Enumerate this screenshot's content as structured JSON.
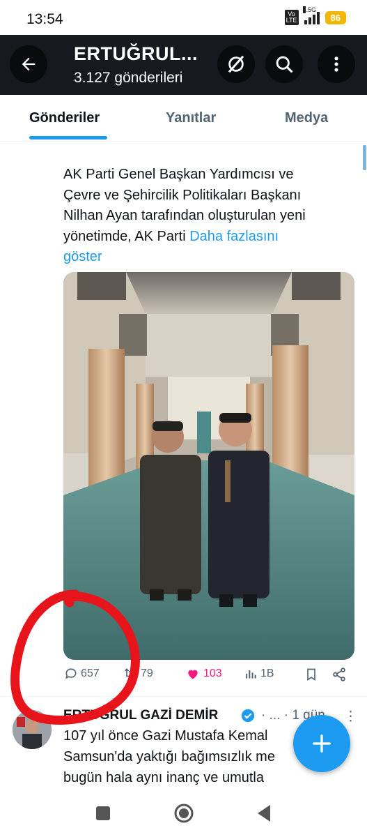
{
  "status_bar": {
    "time": "13:54",
    "volte_label": "Vo LTE",
    "network": "4.5G",
    "battery": "86"
  },
  "header": {
    "title": "ERTUĞRUL...",
    "subtitle": "3.127 gönderileri",
    "icons": [
      "back-arrow-icon",
      "grok-icon",
      "search-icon",
      "more-vertical-icon"
    ]
  },
  "tabs": [
    {
      "label": "Gönderiler",
      "active": true
    },
    {
      "label": "Yanıtlar",
      "active": false
    },
    {
      "label": "Medya",
      "active": false
    }
  ],
  "tweet": {
    "text_lines": [
      "AK Parti Genel Başkan Yardımcısı ve",
      "Çevre ve Şehircilik Politikaları Başkanı",
      "Nilhan Ayan tarafından oluşturulan yeni",
      "yönetimde,  AK Parti "
    ],
    "show_more": "Daha fazlasını",
    "show_more_2": "göster",
    "stats": {
      "replies": "657",
      "reposts": "79",
      "likes": "103",
      "views": "1B"
    }
  },
  "next_tweet": {
    "author": "ERTUĞRUL GAZİ DEMİR",
    "meta": "· ... · 1 gün",
    "line1": "107 yıl önce Gazi Mustafa Kemal",
    "line2": "Samsun'da yaktığı bağımsızlık me",
    "line3": "bugün hala aynı inanç ve umutla"
  },
  "colors": {
    "accent": "#1d9bf0",
    "like": "#f91880",
    "header_bg": "#161a1e",
    "annotation": "#e8141c"
  }
}
